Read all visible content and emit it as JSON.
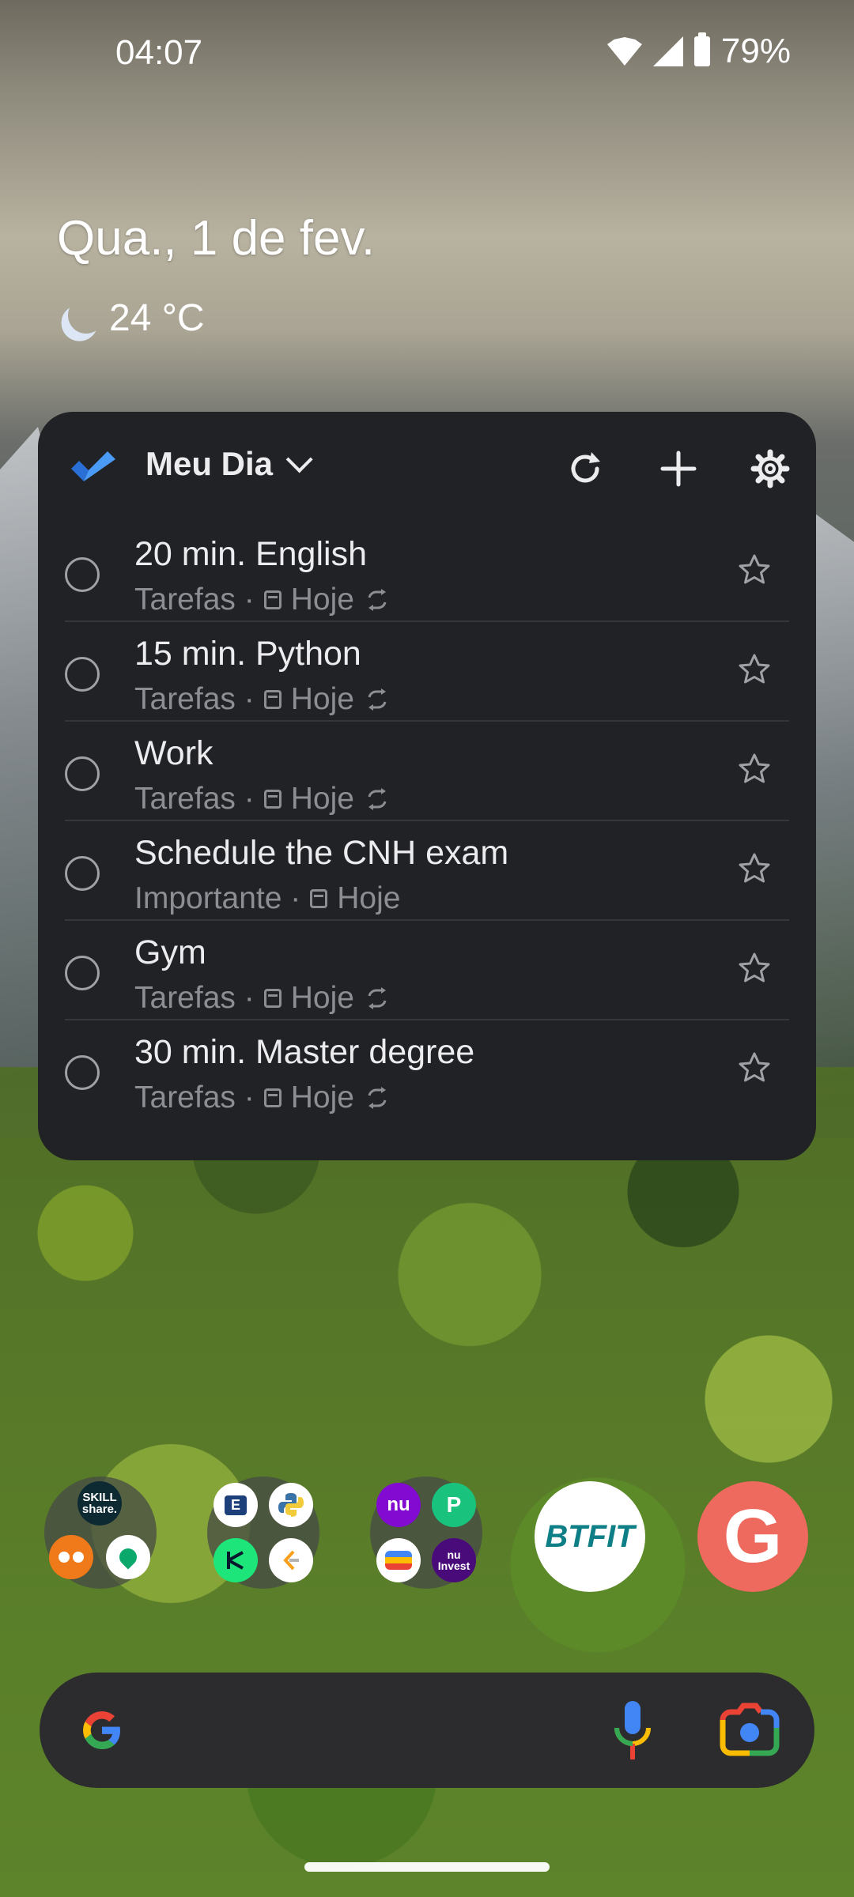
{
  "status_bar": {
    "time": "04:07",
    "battery": "79%",
    "icons": [
      "wifi-icon",
      "signal-icon",
      "battery-icon"
    ]
  },
  "at_a_glance": {
    "date": "Qua., 1 de fev.",
    "weather": "24 °C",
    "weather_icon": "moon-icon"
  },
  "widget": {
    "title": "Meu Dia",
    "accent": "#3f8cf0",
    "actions": [
      "refresh-icon",
      "add-icon",
      "settings-icon"
    ],
    "tasks": [
      {
        "title": "20 min. English",
        "list": "Tarefas ·",
        "due": "Hoje",
        "repeat": true
      },
      {
        "title": "15 min. Python",
        "list": "Tarefas ·",
        "due": "Hoje",
        "repeat": true
      },
      {
        "title": "Work",
        "list": "Tarefas ·",
        "due": "Hoje",
        "repeat": true
      },
      {
        "title": "Schedule the CNH exam",
        "list": "Importante ·",
        "due": "Hoje",
        "repeat": false
      },
      {
        "title": "Gym",
        "list": "Tarefas ·",
        "due": "Hoje",
        "repeat": true
      },
      {
        "title": "30 min. Master degree",
        "list": "Tarefas ·",
        "due": "Hoje",
        "repeat": true
      }
    ]
  },
  "dock": {
    "folder1": {
      "skillshare_label": "SKILL share."
    },
    "folder2": {
      "e_label": "E"
    },
    "folder3": {
      "nu_label": "nu",
      "nu_invest_label": "nu Invest"
    },
    "btfit_label": "BTFIT",
    "g_label": "G"
  }
}
